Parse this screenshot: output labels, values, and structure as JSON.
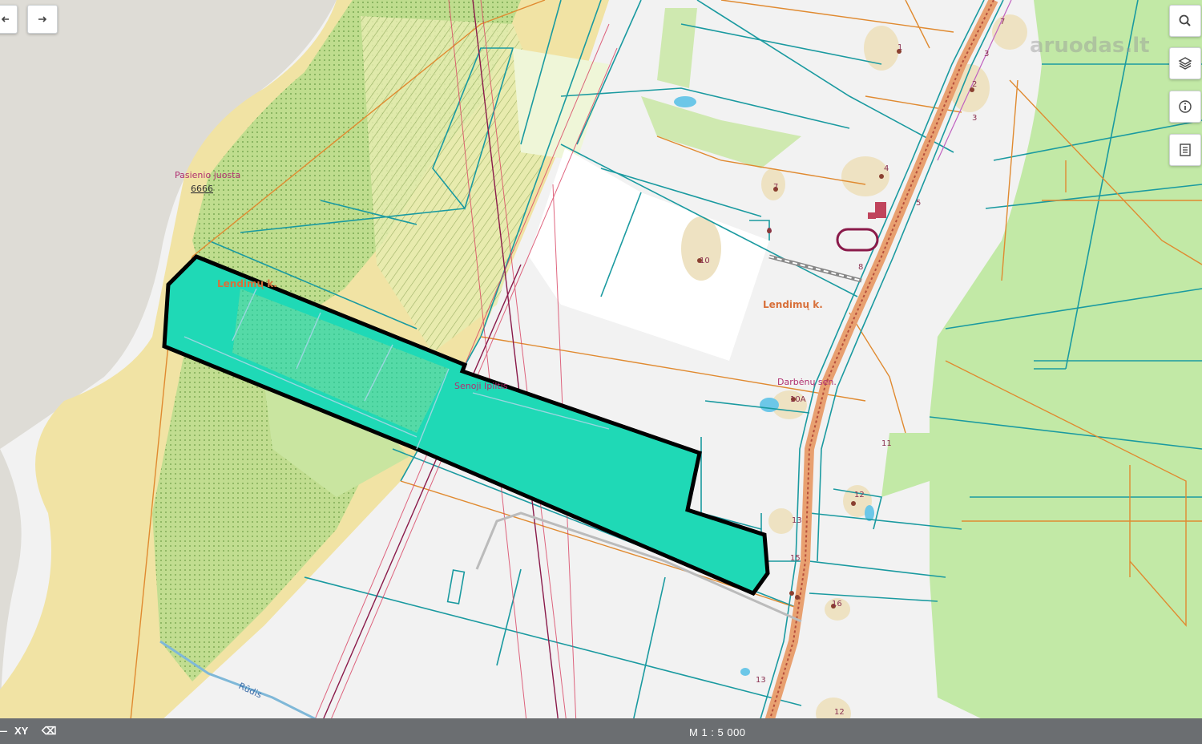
{
  "map": {
    "labels": {
      "pasienio": "Pasienio juosta",
      "pasienio_num": "6666",
      "lendimu_left": "Lendimų k.",
      "lendimu_right": "Lendimų k.",
      "senoji": "Senoji Ipiltis",
      "darbenu": "Darbėnų sen.",
      "rudis": "Rūdis"
    },
    "parcel_numbers": {
      "n1": "1",
      "n2": "2",
      "n3": "3",
      "n4": "4",
      "n5": "5",
      "n7a": "7",
      "n7b": "7",
      "n8": "8",
      "n9": "9",
      "n10": "10",
      "n10a": "10A",
      "n11": "11",
      "n12a": "12",
      "n12b": "12",
      "n13": "13",
      "n15": "15",
      "n16": "16",
      "n10b": "10"
    },
    "colors": {
      "highlight_fill": "#1fd9b6",
      "highlight_outline": "#000000",
      "forest": "#cfe9a6",
      "sand": "#f3e6a6",
      "parcel_line": "#1a9aa0",
      "boundary_line": "#e08a30"
    }
  },
  "toolbar": {
    "back_icon": "arrow-left-icon",
    "forward_icon": "arrow-right-icon",
    "side_icons": [
      "search-icon",
      "layers-icon",
      "info-icon",
      "legend-icon"
    ]
  },
  "watermark": "aruodas.lt",
  "bottombar": {
    "xy_label": "XY",
    "scale": "M 1 : 5 000"
  }
}
